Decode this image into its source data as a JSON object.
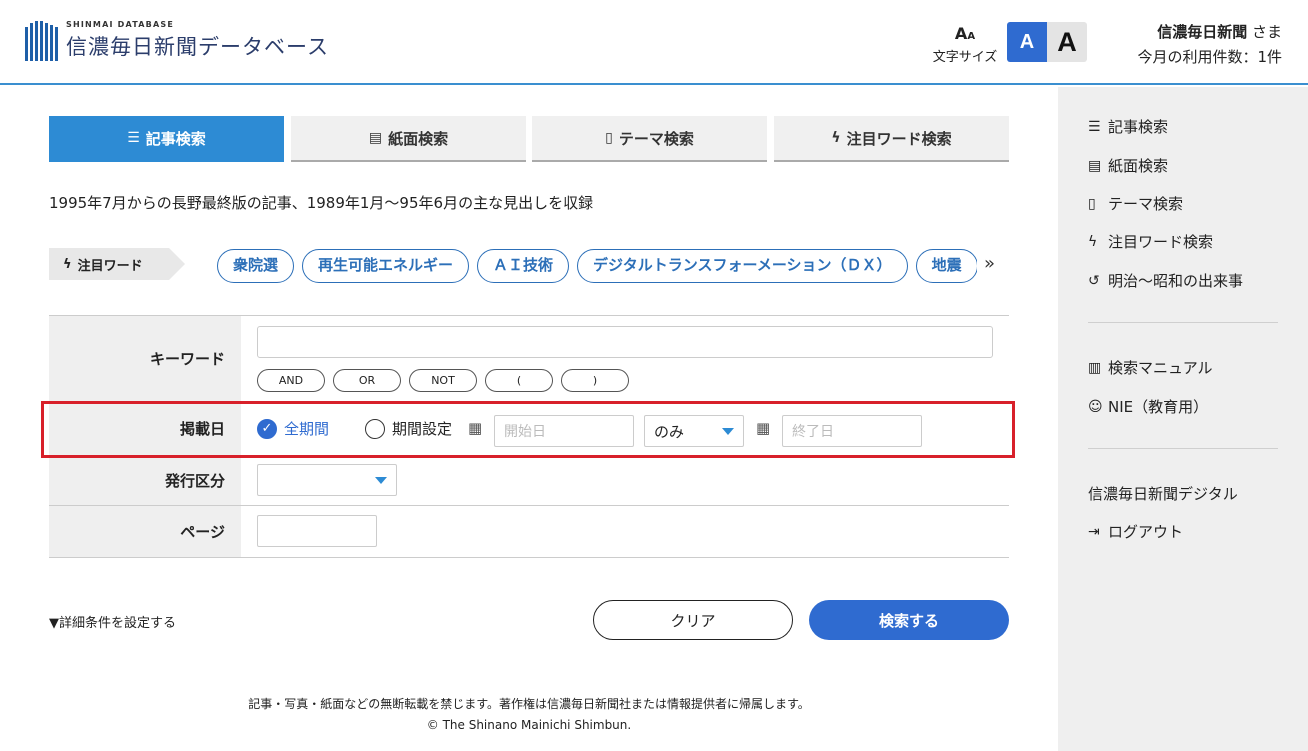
{
  "header": {
    "logo_sub": "SHINMAI DATABASE",
    "logo_main": "信濃毎日新聞データベース",
    "fontsize_label": "文字サイズ",
    "size_small": "A",
    "size_large": "A",
    "user_name": "信濃毎日新聞",
    "user_suffix": "さま",
    "usage": "今月の利用件数：1件"
  },
  "tabs": [
    {
      "label": "記事検索",
      "icon": "list-icon",
      "active": true
    },
    {
      "label": "紙面検索",
      "icon": "newspaper-icon"
    },
    {
      "label": "テーマ検索",
      "icon": "bookmark-icon"
    },
    {
      "label": "注目ワード検索",
      "icon": "bolt-icon"
    }
  ],
  "description": "1995年7月からの長野最終版の記事、1989年1月〜95年6月の主な見出しを収録",
  "attention": {
    "label": "注目ワード",
    "chips": [
      "衆院選",
      "再生可能エネルギー",
      "ＡＩ技術",
      "デジタルトランスフォーメーション（ＤＸ）",
      "地震"
    ]
  },
  "form": {
    "keyword_label": "キーワード",
    "operators": [
      "AND",
      "OR",
      "NOT",
      "(",
      ")"
    ],
    "date_label": "掲載日",
    "all_period": "全期間",
    "set_period": "期間設定",
    "start_placeholder": "開始日",
    "range_select": "のみ",
    "end_placeholder": "終了日",
    "issue_label": "発行区分",
    "page_label": "ページ"
  },
  "actions": {
    "detail": "▼詳細条件を設定する",
    "clear": "クリア",
    "search": "検索する"
  },
  "footer": {
    "notice": "記事・写真・紙面などの無断転載を禁じます。著作権は信濃毎日新聞社または情報提供者に帰属します。",
    "copyright": "© The Shinano Mainichi Shimbun."
  },
  "sidebar": {
    "items": [
      {
        "label": "記事検索",
        "icon": "list-icon"
      },
      {
        "label": "紙面検索",
        "icon": "newspaper-icon"
      },
      {
        "label": "テーマ検索",
        "icon": "bookmark-icon"
      },
      {
        "label": "注目ワード検索",
        "icon": "bolt-icon"
      },
      {
        "label": "明治〜昭和の出来事",
        "icon": "history-icon"
      },
      {
        "label": "検索マニュアル",
        "icon": "book-icon"
      },
      {
        "label": "NIE（教育用）",
        "icon": "face-icon"
      },
      {
        "label": "信濃毎日新聞デジタル",
        "icon": ""
      },
      {
        "label": "ログアウト",
        "icon": "logout-icon"
      }
    ]
  },
  "colors": {
    "accent": "#2d8bd4",
    "primary_button": "#2f6bd0",
    "highlight": "#d8202a"
  }
}
